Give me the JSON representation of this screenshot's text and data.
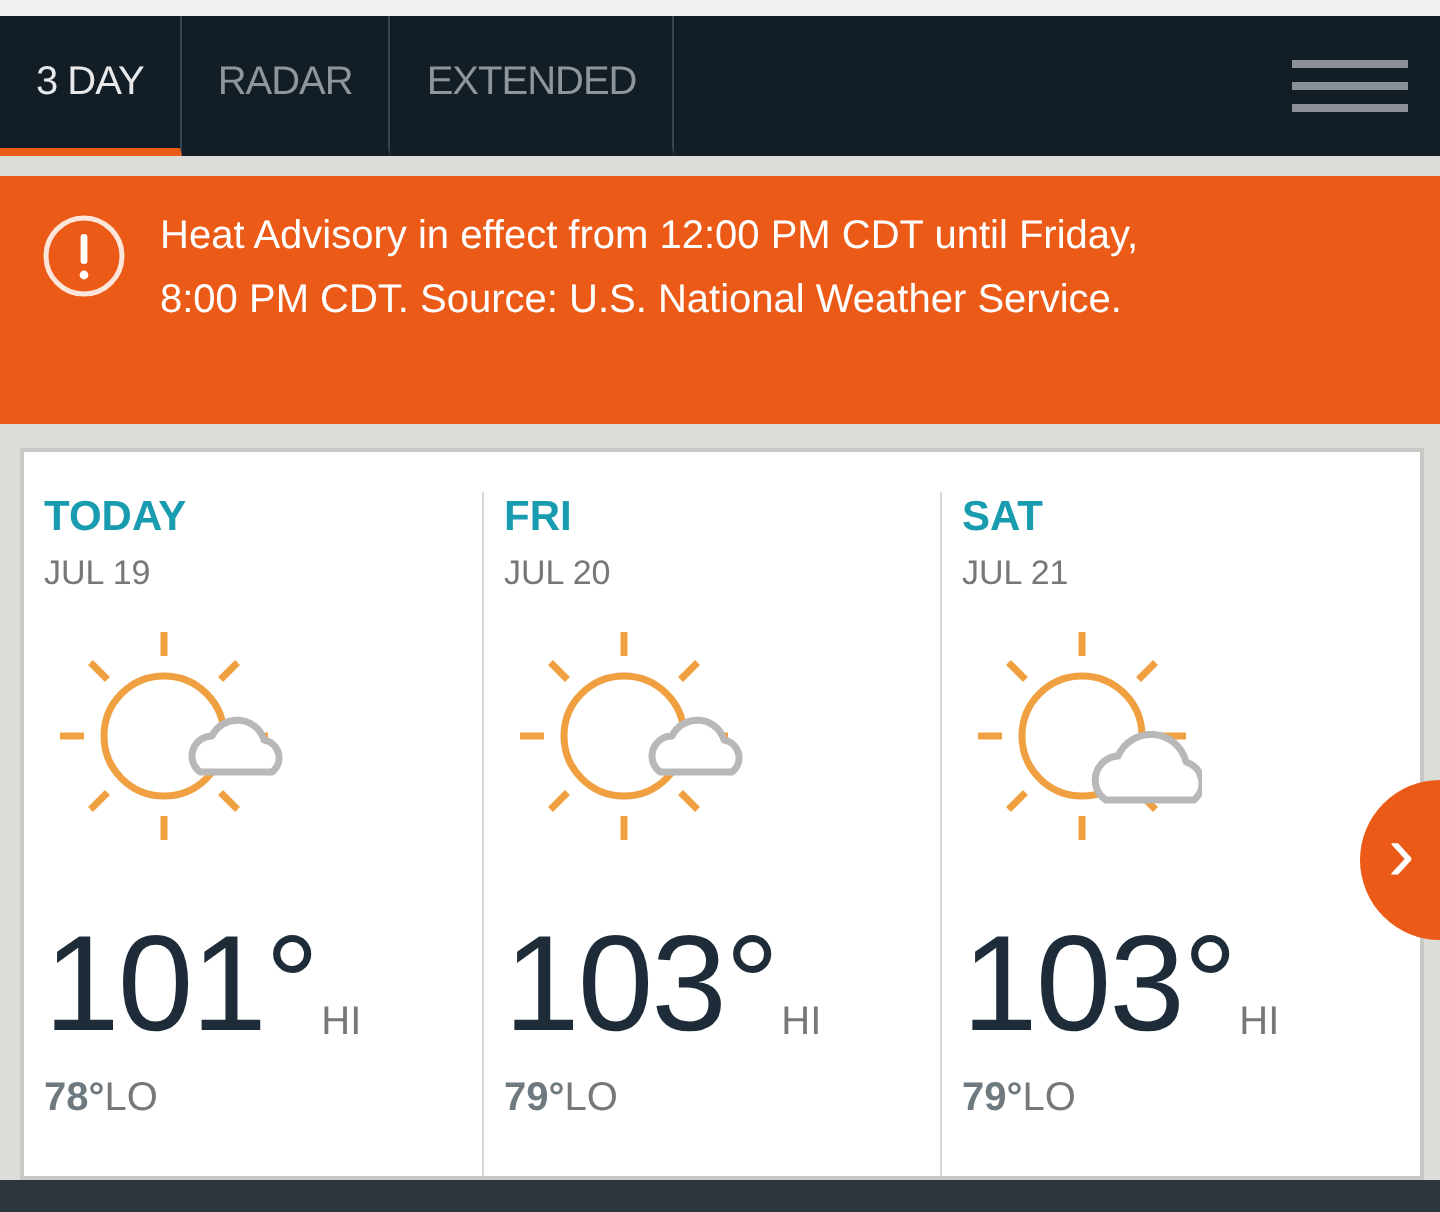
{
  "tabs": [
    {
      "label": "3 DAY",
      "selected": true
    },
    {
      "label": "RADAR",
      "selected": false
    },
    {
      "label": "EXTENDED",
      "selected": false
    }
  ],
  "alert": {
    "text": "Heat Advisory in effect from 12:00 PM CDT until Friday, 8:00 PM CDT. Source: U.S. National Weather Service."
  },
  "days": [
    {
      "day": "TODAY",
      "date": "JUL 19",
      "kind": "mostly-sunny",
      "high": "101°",
      "high_label": "HI",
      "low": "**78°**LO"
    },
    {
      "day": "FRI",
      "date": "JUL 20",
      "kind": "mostly-sunny",
      "high": "103°",
      "high_label": "HI",
      "low": "**79°**LO"
    },
    {
      "day": "SAT",
      "date": "JUL 21",
      "kind": "partly-sunny",
      "high": "103°",
      "high_label": "HI",
      "low": "**79°**LO"
    }
  ],
  "next_button": {
    "symbol": "›"
  }
}
